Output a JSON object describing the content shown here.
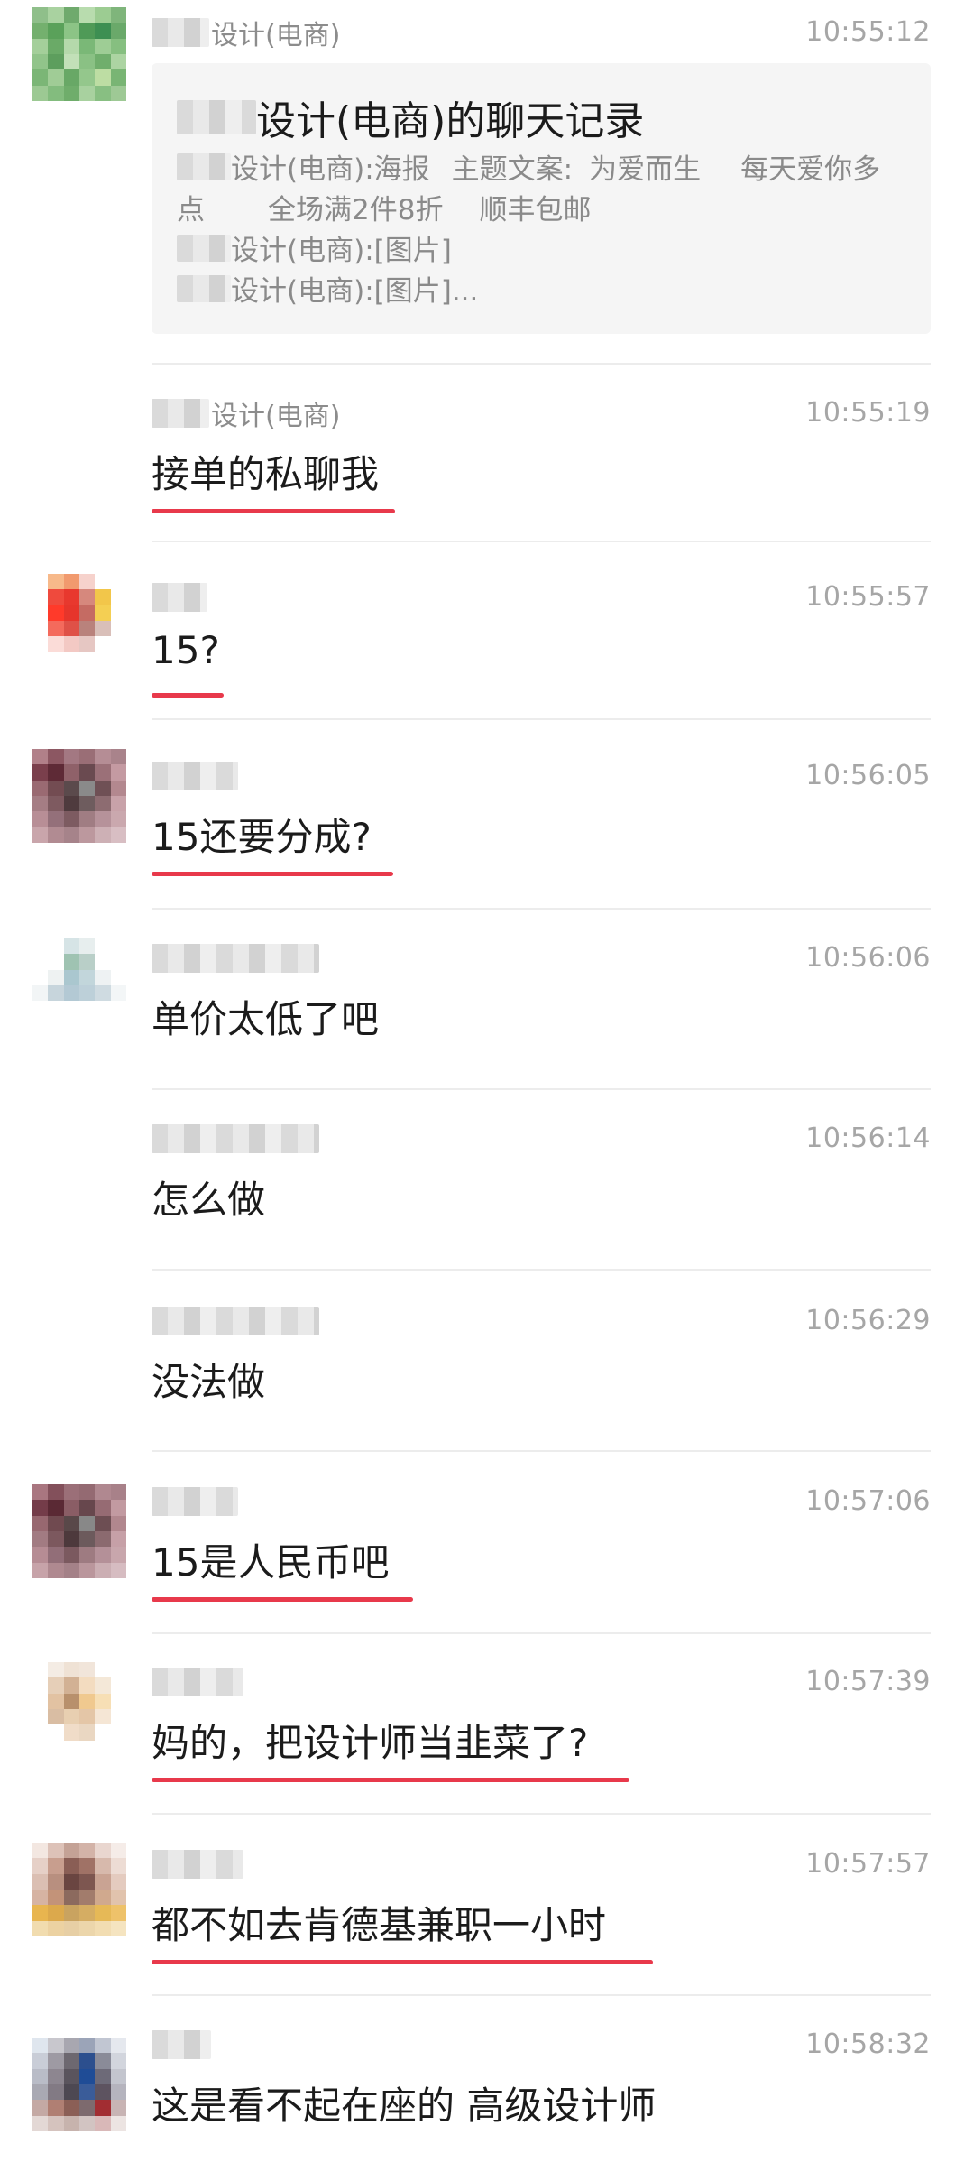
{
  "forwarded": {
    "sender_suffix": "设计(电商)",
    "time": "10:55:12",
    "card_title_suffix": "设计(电商)的聊天记录",
    "line1_suffix": "设计(电商):海报",
    "line1_part2": "主题文案:",
    "line1_part3": "为爱而生",
    "line1_part4": "每天爱你多",
    "line2_part1": "点",
    "line2_part2": "全场满2件8折",
    "line2_part3": "顺丰包邮",
    "line3_suffix": "设计(电商):[图片]",
    "line4_suffix": "设计(电商):[图片]..."
  },
  "messages": [
    {
      "sender_suffix": "设计(电商)",
      "time": "10:55:19",
      "text": "接单的私聊我",
      "underlined": true
    },
    {
      "sender_suffix": "",
      "time": "10:55:57",
      "text": "15?",
      "underlined": true
    },
    {
      "sender_suffix": "",
      "time": "10:56:05",
      "text": "15还要分成?",
      "underlined": true
    },
    {
      "sender_suffix": "",
      "time": "10:56:06",
      "text": "单价太低了吧",
      "underlined": false
    },
    {
      "sender_suffix": "",
      "time": "10:56:14",
      "text": "怎么做",
      "underlined": false
    },
    {
      "sender_suffix": "",
      "time": "10:56:29",
      "text": "没法做",
      "underlined": false
    },
    {
      "sender_suffix": "",
      "time": "10:57:06",
      "text": "15是人民币吧",
      "underlined": true
    },
    {
      "sender_suffix": "",
      "time": "10:57:39",
      "text": "妈的，把设计师当韭菜了?",
      "underlined": true
    },
    {
      "sender_suffix": "",
      "time": "10:57:57",
      "text": "都不如去肯德基兼职一小时",
      "underlined": true
    },
    {
      "sender_suffix": "",
      "time": "10:58:32",
      "text": "这是看不起在座的 高级设计师",
      "underlined": false
    }
  ],
  "colors": {
    "underline": "#e8394b",
    "time": "#a6a6a6",
    "sender": "#8c8c8c",
    "card_bg": "#f5f5f5"
  }
}
